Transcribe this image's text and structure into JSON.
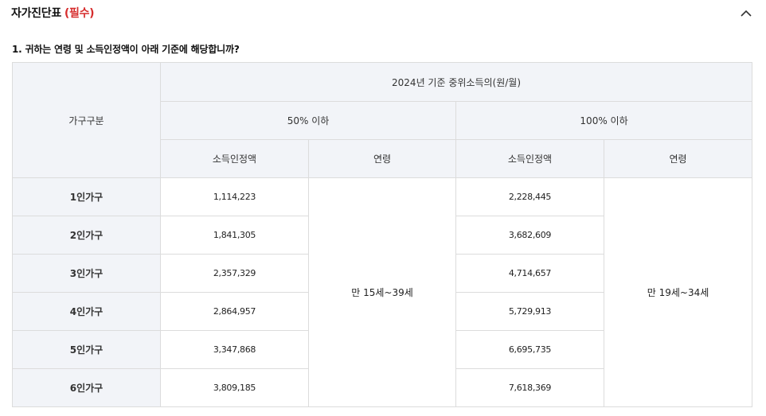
{
  "section": {
    "title": "자가진단표",
    "required_label": "(필수)",
    "accent_color": "#d62d2d"
  },
  "question": {
    "text": "1. 귀하는 연령 및 소득인정액이 아래 기준에 해당합니까?"
  },
  "table": {
    "household_header": "가구구분",
    "income_header": "2024년 기준 중위소득의(원/월)",
    "groups": [
      {
        "label": "50% 이하",
        "income_col": "소득인정액",
        "age_col": "연령",
        "age_value": "만 15세~39세"
      },
      {
        "label": "100% 이하",
        "income_col": "소득인정액",
        "age_col": "연령",
        "age_value": "만 19세~34세"
      }
    ],
    "rows": [
      {
        "household": "1인가구",
        "income_50": "1,114,223",
        "income_100": "2,228,445"
      },
      {
        "household": "2인가구",
        "income_50": "1,841,305",
        "income_100": "3,682,609"
      },
      {
        "household": "3인가구",
        "income_50": "2,357,329",
        "income_100": "4,714,657"
      },
      {
        "household": "4인가구",
        "income_50": "2,864,957",
        "income_100": "5,729,913"
      },
      {
        "household": "5인가구",
        "income_50": "3,347,868",
        "income_100": "6,695,735"
      },
      {
        "household": "6인가구",
        "income_50": "3,809,185",
        "income_100": "7,618,369"
      }
    ],
    "header_bg": "#f2f4f8",
    "border_color": "#dcdcdc"
  },
  "icons": {
    "collapse": "chevron-up-icon"
  }
}
